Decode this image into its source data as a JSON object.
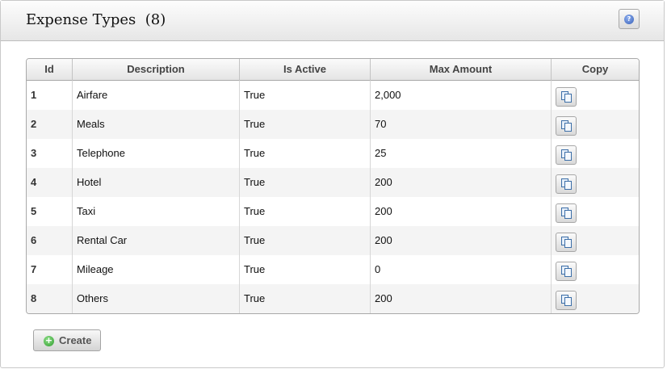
{
  "header": {
    "title": "Expense Types",
    "count": "(8)"
  },
  "help": {
    "icon": "help-icon",
    "glyph": "?"
  },
  "grid": {
    "columns": [
      "Id",
      "Description",
      "Is Active",
      "Max Amount",
      "Copy"
    ],
    "rows": [
      {
        "id": "1",
        "description": "Airfare",
        "is_active": "True",
        "max_amount": "2,000"
      },
      {
        "id": "2",
        "description": "Meals",
        "is_active": "True",
        "max_amount": "70"
      },
      {
        "id": "3",
        "description": "Telephone",
        "is_active": "True",
        "max_amount": "25"
      },
      {
        "id": "4",
        "description": "Hotel",
        "is_active": "True",
        "max_amount": "200"
      },
      {
        "id": "5",
        "description": "Taxi",
        "is_active": "True",
        "max_amount": "200"
      },
      {
        "id": "6",
        "description": "Rental Car",
        "is_active": "True",
        "max_amount": "200"
      },
      {
        "id": "7",
        "description": "Mileage",
        "is_active": "True",
        "max_amount": "0"
      },
      {
        "id": "8",
        "description": "Others",
        "is_active": "True",
        "max_amount": "200"
      }
    ],
    "copy_icon": "copy-icon"
  },
  "actions": {
    "create_label": "Create",
    "create_icon": "plus-circle-icon",
    "create_glyph": "+"
  }
}
